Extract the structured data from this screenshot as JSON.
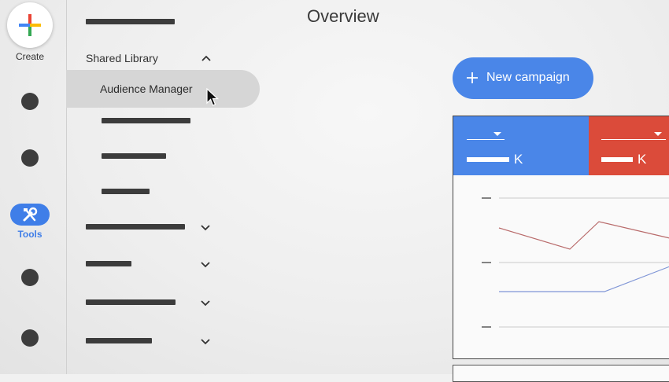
{
  "rail": {
    "create_label": "Create",
    "tools_label": "Tools"
  },
  "menu": {
    "section_title": "Shared Library",
    "active_item": "Audience Manager"
  },
  "main": {
    "page_title": "Overview",
    "new_campaign_label": "New campaign"
  },
  "metrics": {
    "blue_unit": "K",
    "red_unit": "K"
  },
  "colors": {
    "accent_blue": "#4a86e8",
    "accent_red": "#db4b3a",
    "tools_blue": "#3f7ee8"
  },
  "icons": [
    "plus-icon",
    "tools-icon",
    "chevron-up-icon",
    "chevron-down-icon",
    "dropdown-caret-icon"
  ]
}
